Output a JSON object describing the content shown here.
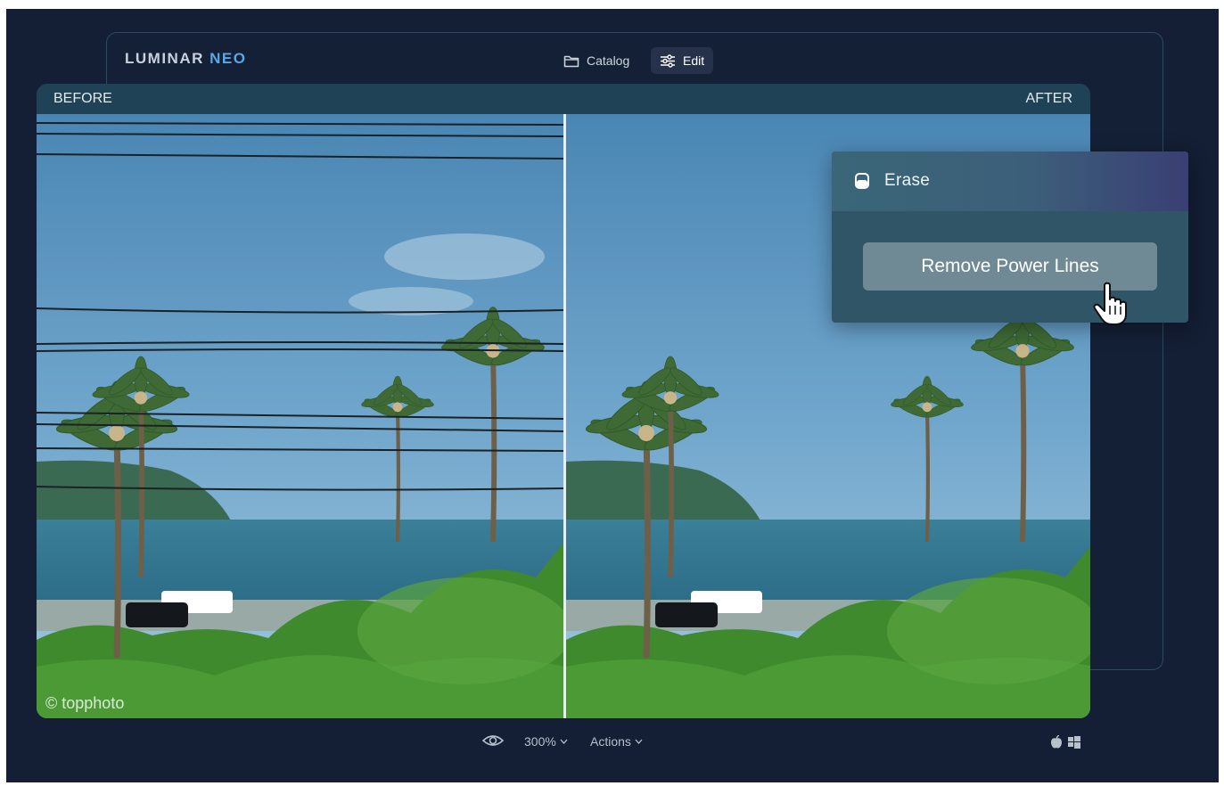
{
  "brand": {
    "part1": "LUMINAR",
    "part2": "NEO"
  },
  "tabs": [
    {
      "label": "Catalog",
      "icon": "folder-icon"
    },
    {
      "label": "Edit",
      "icon": "sliders-icon",
      "active": true
    }
  ],
  "compare": {
    "before_label": "BEFORE",
    "after_label": "AFTER",
    "watermark": "© topphoto"
  },
  "erase_panel": {
    "title": "Erase",
    "icon": "erase-icon",
    "button_label": "Remove Power Lines"
  },
  "bottom_bar": {
    "zoom": "300%",
    "actions": "Actions",
    "icons": [
      "eye-icon",
      "apple-icon",
      "windows-icon"
    ]
  },
  "colors": {
    "background": "#141e34",
    "accent": "#5aa6e6",
    "panel": "#2f5566"
  }
}
